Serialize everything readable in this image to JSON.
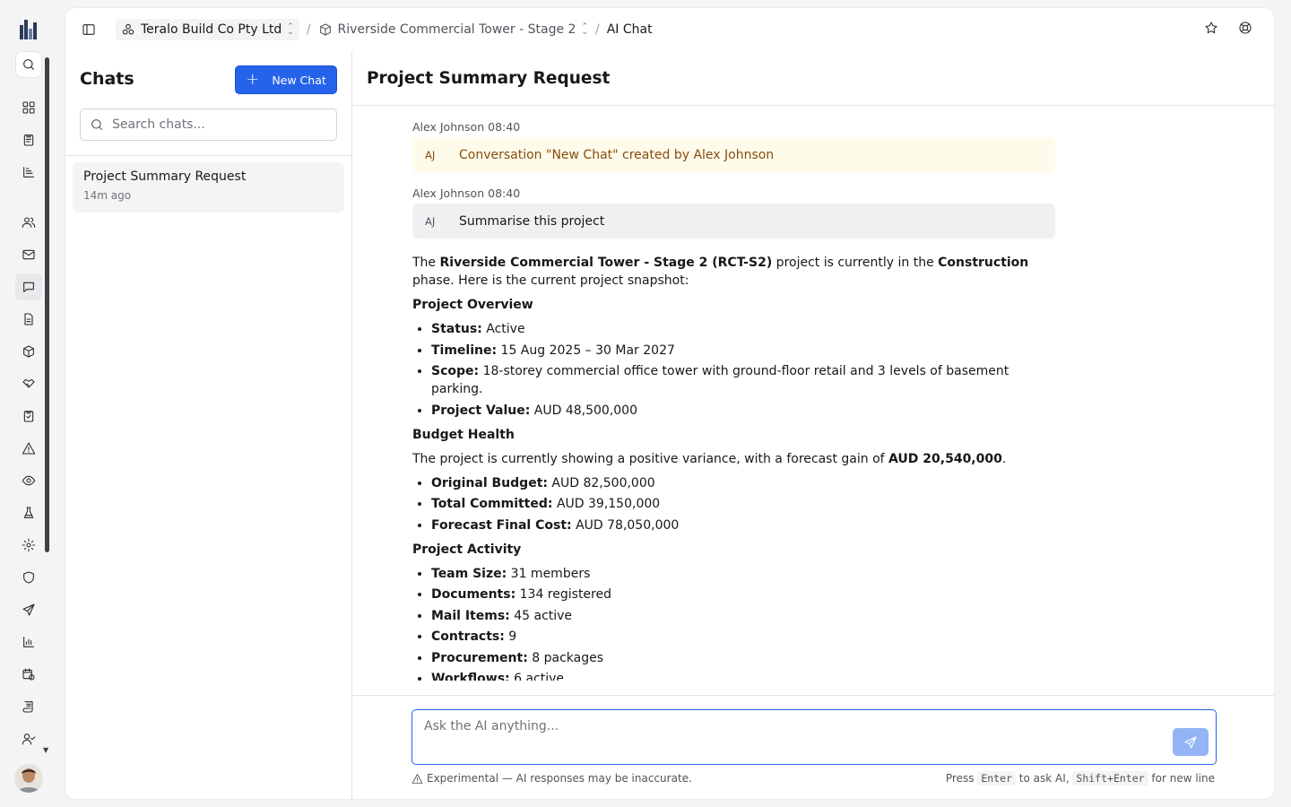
{
  "topbar": {
    "org": "Teralo Build Co Pty Ltd",
    "project": "Riverside Commercial Tower - Stage 2",
    "current": "AI Chat",
    "separator": "/"
  },
  "chats": {
    "title": "Chats",
    "new_chat_label": "New Chat",
    "search_placeholder": "Search chats...",
    "items": [
      {
        "name": "Project Summary Request",
        "time": "14m ago"
      }
    ]
  },
  "conversation": {
    "title": "Project Summary Request",
    "messages": [
      {
        "author": "Alex Johnson",
        "time": "08:40",
        "initials": "AJ",
        "text": "Conversation \"New Chat\" created by Alex Johnson",
        "kind": "system"
      },
      {
        "author": "Alex Johnson",
        "time": "08:40",
        "initials": "AJ",
        "text": "Summarise this project",
        "kind": "user"
      }
    ],
    "answer": {
      "intro_1": "The ",
      "intro_project": "Riverside Commercial Tower - Stage 2 (RCT-S2)",
      "intro_2": " project is currently in the ",
      "intro_phase": "Construction",
      "intro_3": " phase. Here is the current project snapshot:",
      "overview_heading": "Project Overview",
      "overview": [
        {
          "label": "Status:",
          "value": " Active"
        },
        {
          "label": "Timeline:",
          "value": " 15 Aug 2025 – 30 Mar 2027"
        },
        {
          "label": "Scope:",
          "value": " 18-storey commercial office tower with ground-floor retail and 3 levels of basement parking."
        },
        {
          "label": "Project Value:",
          "value": " AUD 48,500,000"
        }
      ],
      "budget_heading": "Budget Health",
      "budget_text_1": "The project is currently showing a positive variance, with a forecast gain of ",
      "budget_gain": "AUD 20,540,000",
      "budget_text_2": ".",
      "budget": [
        {
          "label": "Original Budget:",
          "value": " AUD 82,500,000"
        },
        {
          "label": "Total Committed:",
          "value": " AUD 39,150,000"
        },
        {
          "label": "Forecast Final Cost:",
          "value": " AUD 78,050,000"
        }
      ],
      "activity_heading": "Project Activity",
      "activity": [
        {
          "label": "Team Size:",
          "value": " 31 members"
        },
        {
          "label": "Documents:",
          "value": " 134 registered"
        },
        {
          "label": "Mail Items:",
          "value": " 45 active"
        },
        {
          "label": "Contracts:",
          "value": " 9"
        },
        {
          "label": "Procurement:",
          "value": " 8 packages"
        },
        {
          "label": "Workflows:",
          "value": " 6 active"
        }
      ]
    }
  },
  "composer": {
    "placeholder": "Ask the AI anything...",
    "disclaimer": "Experimental — AI responses may be inaccurate.",
    "hint_press": "Press",
    "hint_enter": "Enter",
    "hint_mid": "to ask AI,",
    "hint_shift": "Shift+Enter",
    "hint_end": "for new line"
  },
  "colors": {
    "accent": "#2563eb",
    "system_bubble": "#fefbea",
    "user_bubble": "#f0f0f2"
  }
}
